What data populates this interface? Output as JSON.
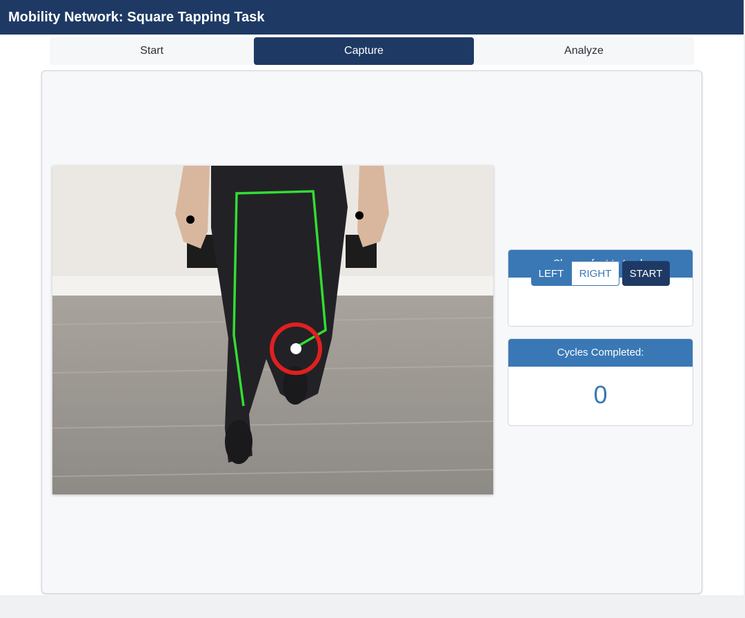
{
  "app": {
    "title": "Mobility Network: Square Tapping Task"
  },
  "tabs": [
    {
      "label": "Start",
      "active": false
    },
    {
      "label": "Capture",
      "active": true
    },
    {
      "label": "Analyze",
      "active": false
    }
  ],
  "foot_selector": {
    "title": "Choose foot to track:",
    "left_label": "LEFT",
    "right_label": "RIGHT",
    "start_label": "START",
    "selected": "LEFT"
  },
  "cycles": {
    "title": "Cycles Completed:",
    "value": "0"
  },
  "colors": {
    "header": "#1e3a64",
    "accent": "#3a78b5",
    "skeleton": "#33dd33",
    "tracker": "#e02020"
  }
}
